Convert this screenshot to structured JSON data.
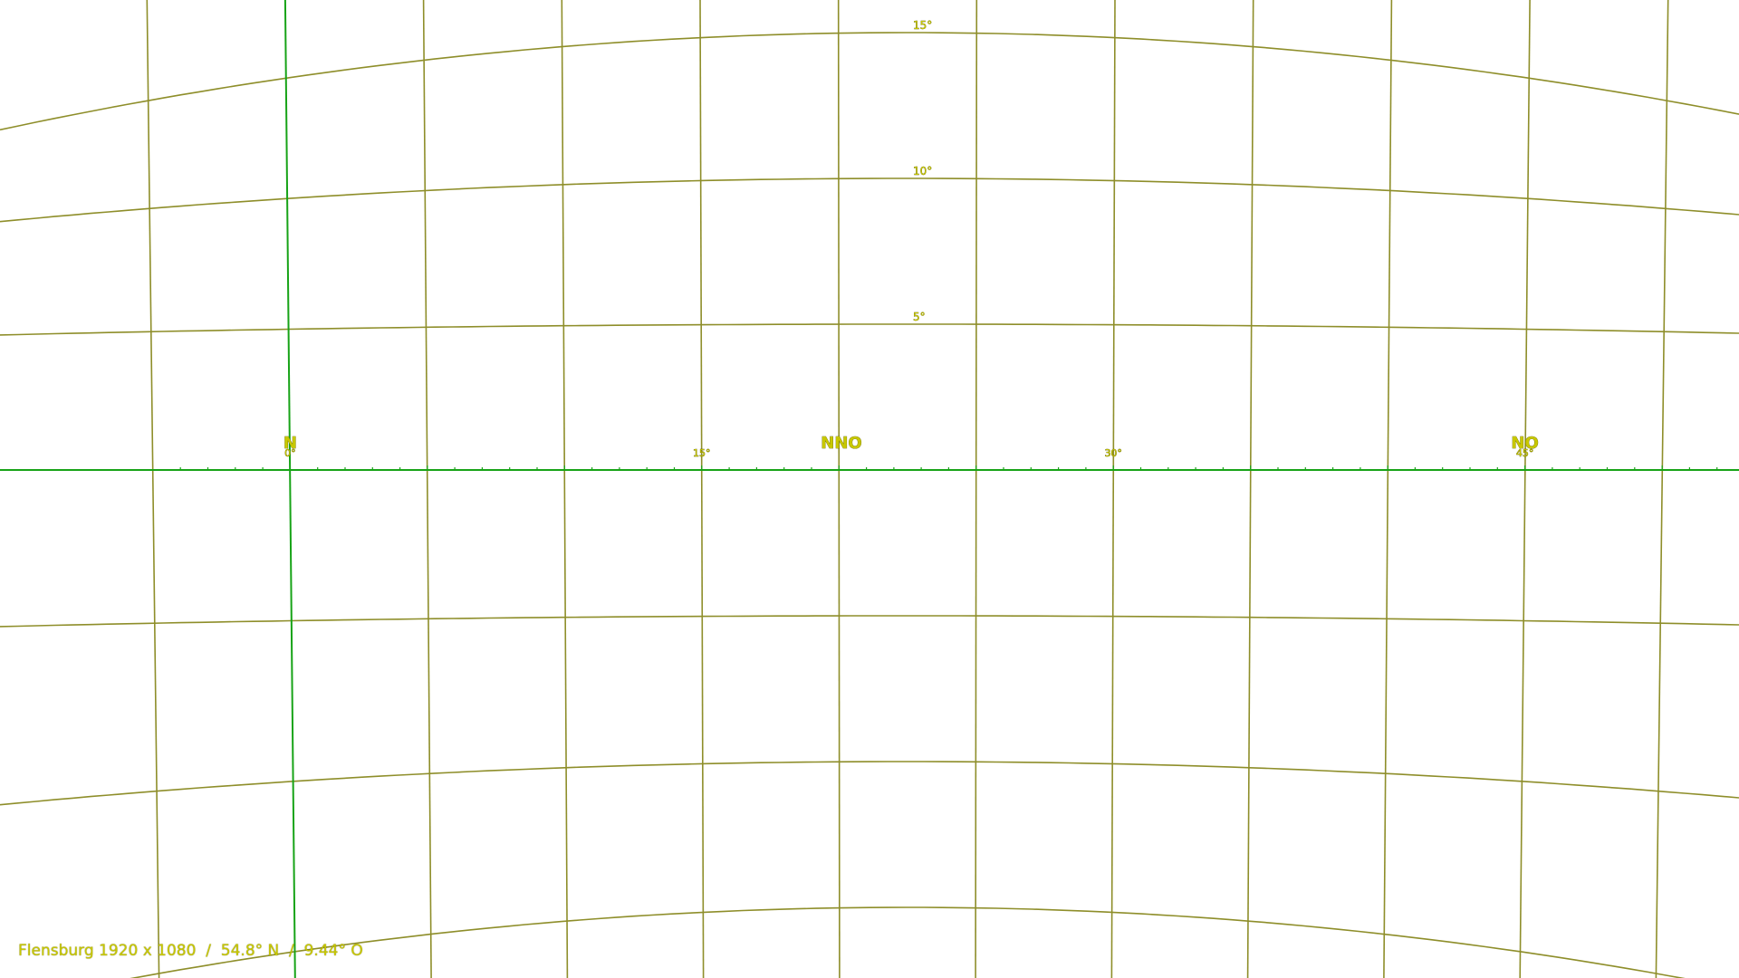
{
  "colors": {
    "grid_line": "#8e8e2a",
    "horizon_line": "#17a317",
    "meridian_line": "#17a317",
    "label_text": "#c8c800",
    "label_outline": "#555500"
  },
  "cardinal_labels": [
    {
      "id": "n",
      "text": "N",
      "az": 0
    },
    {
      "id": "nno",
      "text": "NNO",
      "az": 22.5
    },
    {
      "id": "no",
      "text": "NO",
      "az": 45
    }
  ],
  "azimuth_labels": [
    {
      "id": "az0",
      "text": "0°",
      "az": 0
    },
    {
      "id": "az15",
      "text": "15°",
      "az": 15
    },
    {
      "id": "az30",
      "text": "30°",
      "az": 30
    },
    {
      "id": "az45",
      "text": "45°",
      "az": 45
    }
  ],
  "altitude_labels": [
    {
      "id": "alt15",
      "text": "15°",
      "alt": 15
    },
    {
      "id": "alt10",
      "text": "10°",
      "alt": 10
    },
    {
      "id": "alt5",
      "text": "5°",
      "alt": 5
    }
  ],
  "footer": {
    "caption": "Flensburg 1920 x 1080  /  54.8° N  /  9.44° O"
  }
}
